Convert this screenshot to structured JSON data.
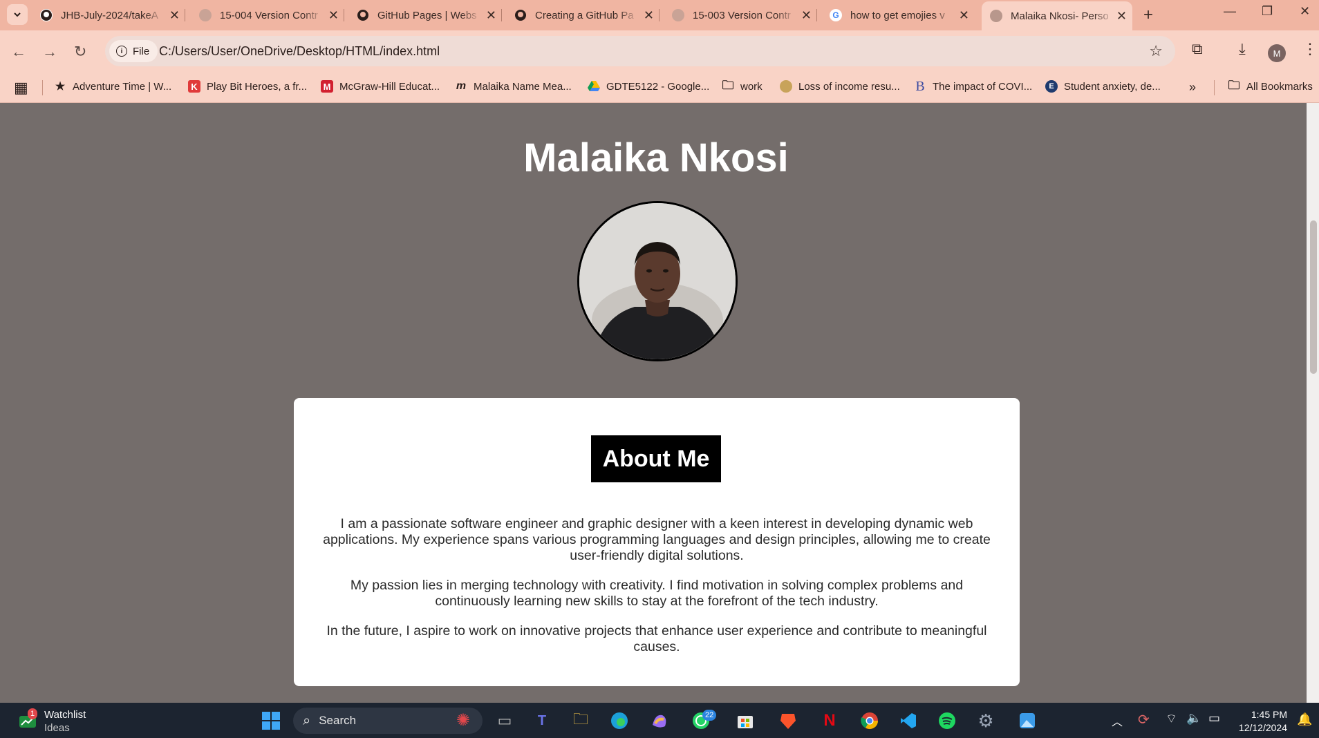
{
  "browser": {
    "tabs": [
      {
        "title": "JHB-July-2024/takeA",
        "icon": "github-icon"
      },
      {
        "title": "15-004 Version Contr",
        "icon": "globe-icon"
      },
      {
        "title": "GitHub Pages | Webs",
        "icon": "github-icon"
      },
      {
        "title": "Creating a GitHub Pa",
        "icon": "github-icon"
      },
      {
        "title": "15-003 Version Contr",
        "icon": "globe-icon"
      },
      {
        "title": "how to get emojies v",
        "icon": "google-icon"
      },
      {
        "title": "Malaika Nkosi- Perso",
        "icon": "globe-icon",
        "active": true
      }
    ],
    "chip_label": "File",
    "url": "C:/Users/User/OneDrive/Desktop/HTML/index.html",
    "profile_initial": "M",
    "bookmarks": [
      {
        "label": "Adventure Time | W...",
        "icon": "star-icon"
      },
      {
        "label": "Play Bit Heroes, a fr...",
        "icon": "kongregate-icon"
      },
      {
        "label": "McGraw-Hill Educat...",
        "icon": "mcgraw-hill-icon"
      },
      {
        "label": "Malaika Name Mea...",
        "icon": "m-script-icon"
      },
      {
        "label": "GDTE5122 - Google...",
        "icon": "google-drive-icon"
      },
      {
        "label": "work",
        "icon": "folder-icon"
      },
      {
        "label": "Loss of income resu...",
        "icon": "crest-icon"
      },
      {
        "label": "The impact of COVI...",
        "icon": "b-letter-icon"
      },
      {
        "label": "Student anxiety, de...",
        "icon": "e-circle-icon"
      }
    ],
    "all_bookmarks_label": "All Bookmarks"
  },
  "page": {
    "name": "Malaika Nkosi",
    "about_heading": "About Me",
    "paragraphs": [
      "I am a passionate software engineer and graphic designer with a keen interest in developing dynamic web applications. My experience spans various programming languages and design principles, allowing me to create user-friendly digital solutions.",
      "My passion lies in merging technology with creativity. I find motivation in solving complex problems and continuously learning new skills to stay at the forefront of the tech industry.",
      "In the future, I aspire to work on innovative projects that enhance user experience and contribute to meaningful causes."
    ]
  },
  "taskbar": {
    "watchlist_title": "Watchlist",
    "watchlist_sub": "Ideas",
    "watchlist_badge": "1",
    "search_label": "Search",
    "whatsapp_badge": "22",
    "time": "1:45 PM",
    "date": "12/12/2024"
  },
  "colors": {
    "tab_strip": "#f0b5a2",
    "toolbar": "#f9d3c6",
    "page_bg": "#746d6b",
    "card_bg": "#ffffff",
    "heading_bg": "#000000"
  }
}
